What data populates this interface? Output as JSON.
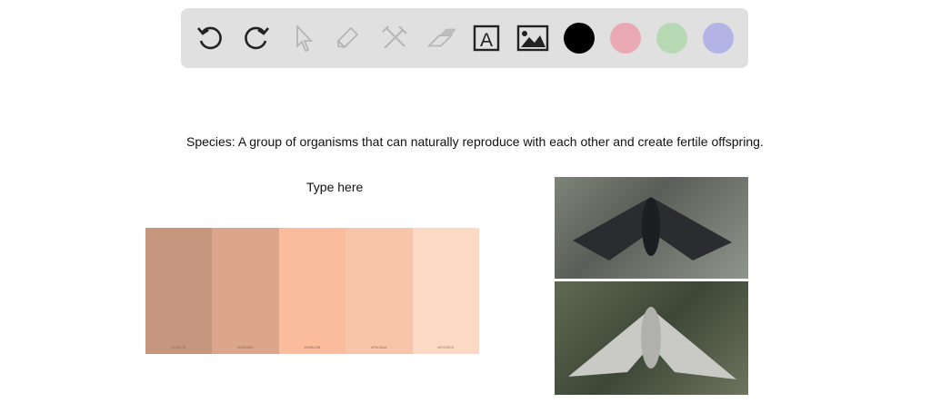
{
  "toolbar": {
    "tools": [
      {
        "name": "undo-icon",
        "enabled": true
      },
      {
        "name": "redo-icon",
        "enabled": true
      },
      {
        "name": "select-pointer-icon",
        "enabled": false
      },
      {
        "name": "pencil-icon",
        "enabled": false
      },
      {
        "name": "tools-icon",
        "enabled": false
      },
      {
        "name": "eraser-icon",
        "enabled": false
      },
      {
        "name": "text-tool-icon",
        "enabled": true
      },
      {
        "name": "image-tool-icon",
        "enabled": true
      }
    ],
    "text_tool_glyph": "A",
    "colors": [
      "#000000",
      "#e8a9b2",
      "#b6d8b3",
      "#b3b3e6"
    ]
  },
  "canvas": {
    "definition": "Species: A group of organisms that can naturally reproduce with each other and create fertile offspring.",
    "text_placeholder": "Type here",
    "palette": [
      {
        "color": "#c6977e",
        "label": "#C6977E"
      },
      {
        "color": "#dba68c",
        "label": "#DBA68C"
      },
      {
        "color": "#fbbc9b",
        "label": "#FBBC9B"
      },
      {
        "color": "#f9c5aa",
        "label": "#F9C5AA"
      },
      {
        "color": "#fcd9c4",
        "label": "#FCD9C4"
      }
    ]
  }
}
